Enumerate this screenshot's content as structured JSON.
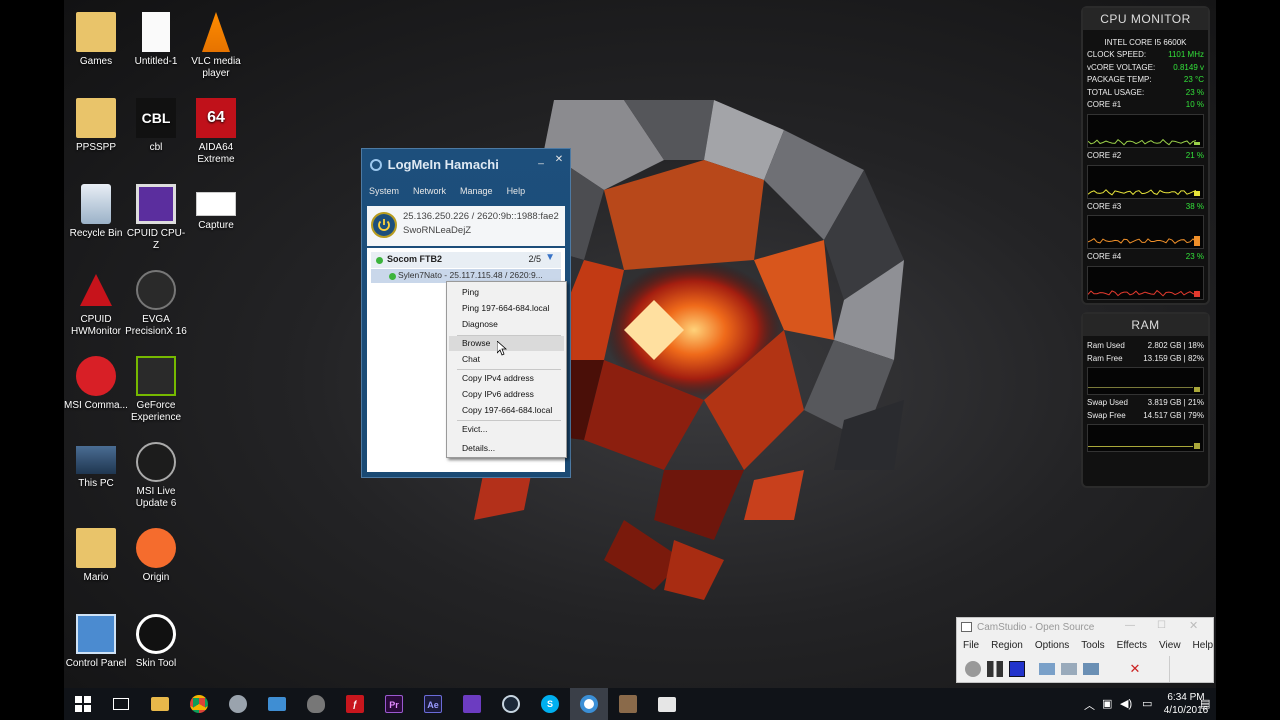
{
  "desktop_icons": [
    {
      "label": "Games",
      "icon": "games-folder-icon"
    },
    {
      "label": "Untitled-1",
      "icon": "blank-document-icon"
    },
    {
      "label": "VLC media player",
      "icon": "vlc-cone-icon"
    },
    {
      "label": "PPSSPP",
      "icon": "ppsspp-folder-icon"
    },
    {
      "label": "cbl",
      "icon": "cbl-icon"
    },
    {
      "label": "AIDA64 Extreme",
      "icon": "aida64-icon"
    },
    {
      "label": "Recycle Bin",
      "icon": "recycle-bin-icon"
    },
    {
      "label": "CPUID CPU-Z",
      "icon": "cpuz-icon"
    },
    {
      "label": "Capture",
      "icon": "capture-image-icon"
    },
    {
      "label": "CPUID HWMonitor",
      "icon": "hwmonitor-icon"
    },
    {
      "label": "EVGA PrecisionX 16",
      "icon": "evga-precision-icon"
    },
    {
      "label": "MSI Comma...",
      "icon": "msi-command-icon"
    },
    {
      "label": "GeForce Experience",
      "icon": "geforce-icon"
    },
    {
      "label": "This PC",
      "icon": "this-pc-icon"
    },
    {
      "label": "MSI Live Update 6",
      "icon": "msi-live-update-icon"
    },
    {
      "label": "Mario",
      "icon": "mario-folder-icon"
    },
    {
      "label": "Origin",
      "icon": "origin-icon"
    },
    {
      "label": "Control Panel",
      "icon": "control-panel-icon"
    },
    {
      "label": "Skin Tool",
      "icon": "skin-tool-icon"
    }
  ],
  "cpu_monitor": {
    "title": "CPU MONITOR",
    "cpu_name": "INTEL CORE I5 6600K",
    "stats": [
      {
        "label": "CLOCK SPEED:",
        "value": "1101 MHz"
      },
      {
        "label": "vCORE VOLTAGE:",
        "value": "0.8149 v"
      },
      {
        "label": "PACKAGE TEMP:",
        "value": "23 °C"
      },
      {
        "label": "TOTAL USAGE:",
        "value": "23 %"
      }
    ],
    "cores": [
      {
        "label": "CORE #1",
        "value": "10 %",
        "color": "#9bd14a",
        "usage": 0.1
      },
      {
        "label": "CORE #2",
        "value": "21 %",
        "color": "#e7e43a",
        "usage": 0.21
      },
      {
        "label": "CORE #3",
        "value": "38 %",
        "color": "#f0902a",
        "usage": 0.38
      },
      {
        "label": "CORE #4",
        "value": "23 %",
        "color": "#e33a2e",
        "usage": 0.23
      }
    ]
  },
  "ram_monitor": {
    "title": "RAM",
    "rows": [
      {
        "label": "Ram Used",
        "value": "2.802 GB",
        "pct": "18%"
      },
      {
        "label": "Ram Free",
        "value": "13.159 GB",
        "pct": "82%"
      },
      {
        "label": "Swap Used",
        "value": "3.819 GB",
        "pct": "21%"
      },
      {
        "label": "Swap Free",
        "value": "14.517 GB",
        "pct": "79%"
      }
    ]
  },
  "hamachi": {
    "title": "LogMeIn Hamachi",
    "menu": [
      "System",
      "Network",
      "Manage",
      "Help"
    ],
    "ip": "25.136.250.226 / 2620:9b::1988:fae2",
    "client_id": "SwoRNLeaDejZ",
    "network": {
      "name": "Socom FTB2",
      "count": "2/5"
    },
    "peer": "Sylen7Nato - 25.117.115.48 / 2620:9..."
  },
  "context_menu": {
    "items": [
      "Ping",
      "Ping 197-664-684.local",
      "Diagnose",
      "Browse",
      "Chat",
      "Copy IPv4 address",
      "Copy IPv6 address",
      "Copy 197-664-684.local",
      "Evict...",
      "Details..."
    ],
    "highlighted": "Browse"
  },
  "camstudio": {
    "title": "CamStudio - Open Source",
    "menu": [
      "File",
      "Region",
      "Options",
      "Tools",
      "Effects",
      "View",
      "Help"
    ]
  },
  "taskbar": {
    "apps": [
      "start-button",
      "task-view",
      "file-explorer",
      "chrome",
      "steam-gear",
      "mail",
      "alienware",
      "flash",
      "premiere",
      "after-effects",
      "cpu-app",
      "steam",
      "skype",
      "hamachi",
      "chef",
      "notes"
    ],
    "premiere_label": "Pr",
    "after_effects_label": "Ae",
    "time": "6:34 PM",
    "date": "4/10/2016"
  },
  "colors": {
    "accent_green": "#33e13a",
    "hamachi_blue": "#1d4f7c",
    "taskbar": "#101318"
  }
}
